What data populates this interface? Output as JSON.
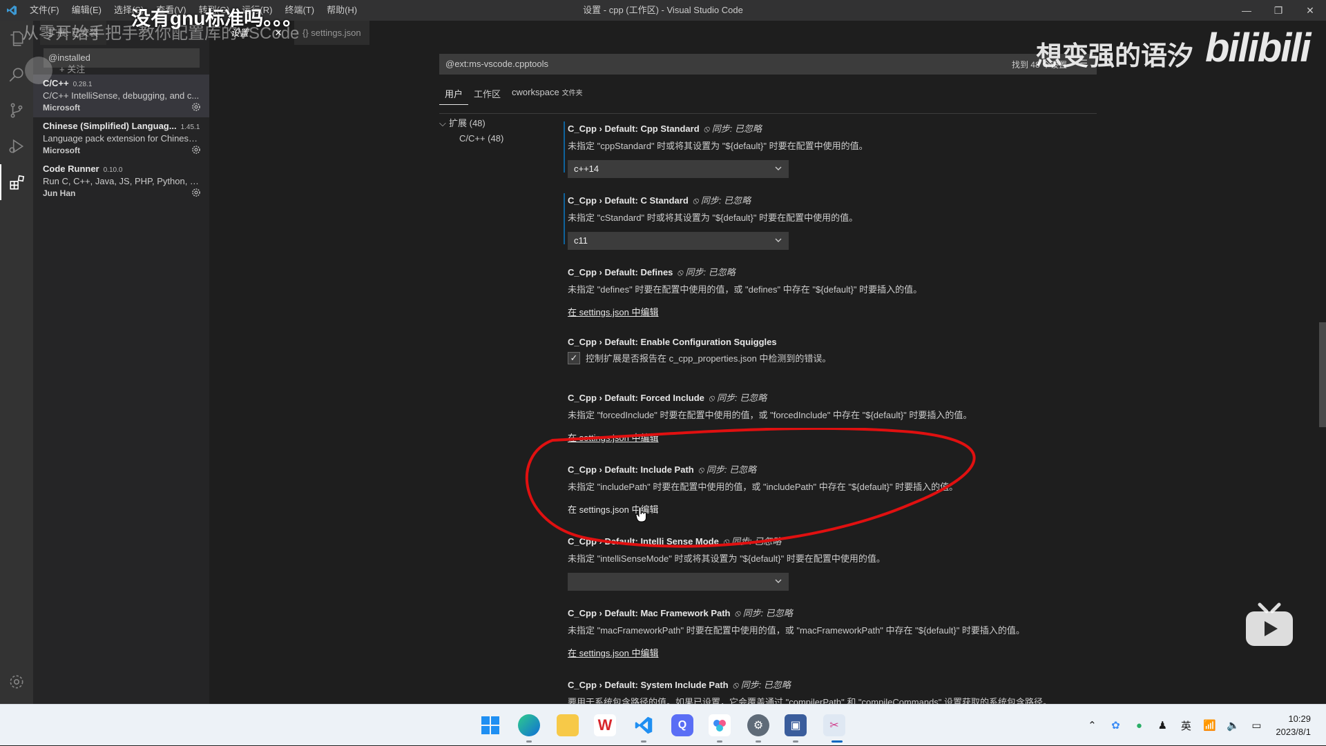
{
  "titlebar": {
    "menus": [
      "文件(F)",
      "编辑(E)",
      "选择(S)",
      "查看(V)",
      "转到(G)",
      "运行(R)",
      "终端(T)",
      "帮助(H)"
    ],
    "window_title": "设置 - cpp (工作区) - Visual Studio Code"
  },
  "tabs": {
    "extensions": "扩展: 已安装",
    "settings": "设置",
    "settings_json": "{} settings.json"
  },
  "sidebar": {
    "search_value": "@installed",
    "extensions": [
      {
        "name": "C/C++",
        "version": "0.28.1",
        "description": "C/C++ IntelliSense, debugging, and c...",
        "publisher": "Microsoft"
      },
      {
        "name": "Chinese (Simplified) Languag...",
        "version": "1.45.1",
        "description": "Language pack extension for Chinese ...",
        "publisher": "Microsoft"
      },
      {
        "name": "Code Runner",
        "version": "0.10.0",
        "description": "Run C, C++, Java, JS, PHP, Python, Perl...",
        "publisher": "Jun Han"
      }
    ]
  },
  "settings": {
    "search_value": "@ext:ms-vscode.cpptools",
    "found_count": "找到 48 个设置",
    "scope_tabs": {
      "user": "用户",
      "workspace": "工作区",
      "folder": "cworkspace",
      "folder_suffix": "文件夹"
    },
    "toc": {
      "group": "扩展 (48)",
      "child": "C/C++ (48)"
    },
    "sync_label": "同步: 已忽略",
    "edit_link": "在 settings.json 中编辑",
    "items": [
      {
        "title": "C_Cpp › Default: Cpp Standard",
        "desc": "未指定 \"cppStandard\" 时或将其设置为 \"${default}\" 时要在配置中使用的值。",
        "select": "c++14"
      },
      {
        "title": "C_Cpp › Default: C Standard",
        "desc": "未指定 \"cStandard\" 时或将其设置为 \"${default}\" 时要在配置中使用的值。",
        "select": "c11"
      },
      {
        "title": "C_Cpp › Default: Defines",
        "desc": "未指定 \"defines\" 时要在配置中使用的值，或 \"defines\" 中存在 \"${default}\" 时要插入的值。"
      },
      {
        "title": "C_Cpp › Default: Enable Configuration Squiggles",
        "desc": "控制扩展是否报告在 c_cpp_properties.json 中检测到的错误。"
      },
      {
        "title": "C_Cpp › Default: Forced Include",
        "desc": "未指定 \"forcedInclude\" 时要在配置中使用的值，或 \"forcedInclude\" 中存在 \"${default}\" 时要插入的值。"
      },
      {
        "title": "C_Cpp › Default: Include Path",
        "desc": "未指定 \"includePath\" 时要在配置中使用的值，或 \"includePath\" 中存在 \"${default}\" 时要插入的值。"
      },
      {
        "title": "C_Cpp › Default: Intelli Sense Mode",
        "desc": "未指定 \"intelliSenseMode\" 时或将其设置为 \"${default}\" 时要在配置中使用的值。",
        "select": ""
      },
      {
        "title": "C_Cpp › Default: Mac Framework Path",
        "desc": "未指定 \"macFrameworkPath\" 时要在配置中使用的值，或 \"macFrameworkPath\" 中存在 \"${default}\" 时要插入的值。"
      },
      {
        "title": "C_Cpp › Default: System Include Path",
        "desc": "要用于系统包含路径的值。如果已设置，它会覆盖通过 \"compilerPath\" 和 \"compileCommands\" 设置获取的系统包含路径。"
      }
    ]
  },
  "overlay": {
    "caption": "没有gnu标准吗。。。",
    "subtitle": "从零开始手把手教你配置库的VSCode",
    "follow": "+ 关注",
    "watermark_name": "想变强的语汐",
    "watermark_logo": "bilibili"
  },
  "taskbar": {
    "ime": "英",
    "time": "10:29",
    "date": "2023/8/1"
  },
  "colors": {
    "accent": "#0e639c",
    "annotation": "#e01010"
  }
}
